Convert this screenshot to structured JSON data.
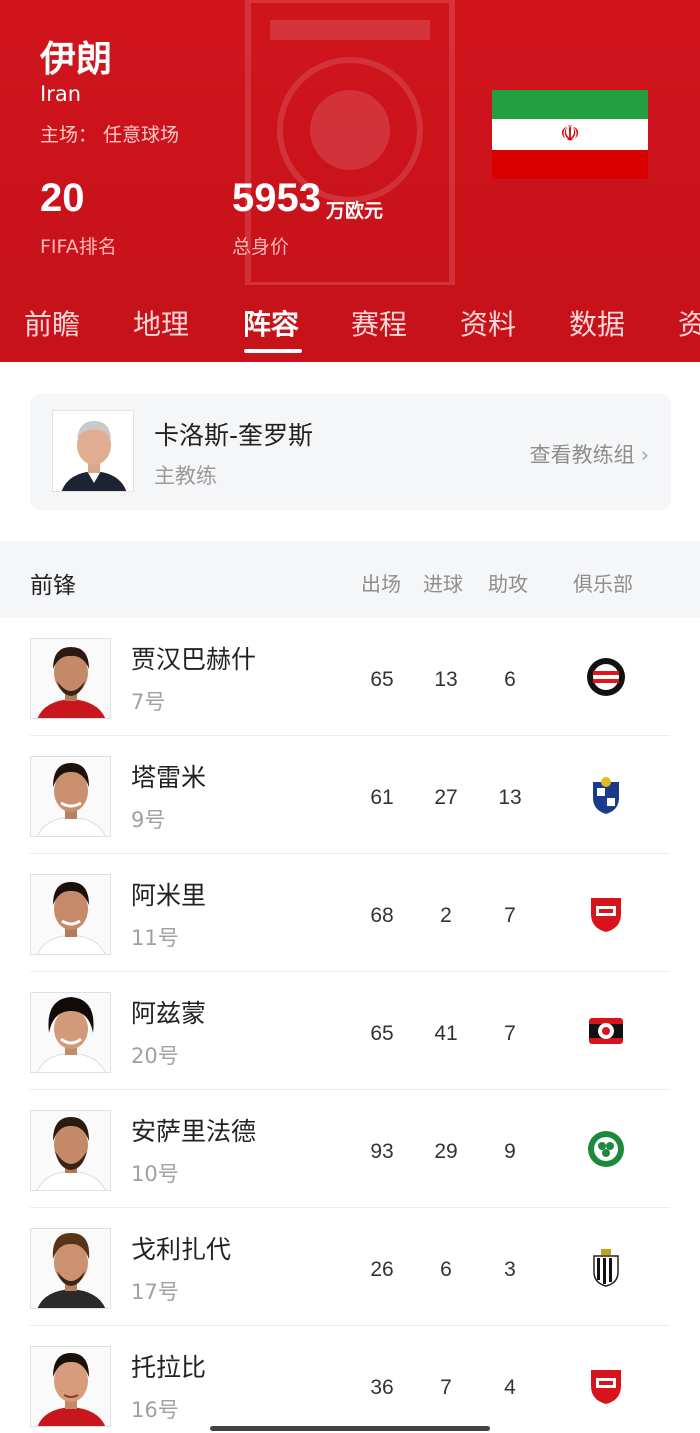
{
  "team": {
    "name_cn": "伊朗",
    "name_en": "Iran",
    "home_label": "主场：",
    "home_value": "任意球场",
    "fifa_rank": "20",
    "fifa_rank_label": "FIFA排名",
    "market_value": "5953",
    "market_value_unit": "万欧元",
    "market_value_label": "总身价"
  },
  "tabs": [
    {
      "label": "前瞻"
    },
    {
      "label": "地理"
    },
    {
      "label": "阵容",
      "active": true
    },
    {
      "label": "赛程"
    },
    {
      "label": "资料"
    },
    {
      "label": "数据"
    },
    {
      "label": "资"
    }
  ],
  "coach": {
    "name": "卡洛斯-奎罗斯",
    "role": "主教练",
    "link": "查看教练组",
    "link_chevron": "›"
  },
  "section": {
    "title": "前锋",
    "col_apps": "出场",
    "col_goals": "进球",
    "col_assists": "助攻",
    "col_club": "俱乐部"
  },
  "players": [
    {
      "name": "贾汉巴赫什",
      "number": "7号",
      "apps": "65",
      "goals": "13",
      "assists": "6",
      "club_icon": "feyenoord-crest"
    },
    {
      "name": "塔雷米",
      "number": "9号",
      "apps": "61",
      "goals": "27",
      "assists": "13",
      "club_icon": "porto-crest"
    },
    {
      "name": "阿米里",
      "number": "11号",
      "apps": "68",
      "goals": "2",
      "assists": "7",
      "club_icon": "persepolis-crest"
    },
    {
      "name": "阿兹蒙",
      "number": "20号",
      "apps": "65",
      "goals": "41",
      "assists": "7",
      "club_icon": "leverkusen-crest"
    },
    {
      "name": "安萨里法德",
      "number": "10号",
      "apps": "93",
      "goals": "29",
      "assists": "9",
      "club_icon": "omonoia-crest"
    },
    {
      "name": "戈利扎代",
      "number": "17号",
      "apps": "26",
      "goals": "6",
      "assists": "3",
      "club_icon": "charleroi-crest"
    },
    {
      "name": "托拉比",
      "number": "16号",
      "apps": "36",
      "goals": "7",
      "assists": "4",
      "club_icon": "persepolis-crest"
    }
  ],
  "colors": {
    "header_red": "#d0141c",
    "tab_red": "#c8121a",
    "card_bg": "#f5f6f8"
  }
}
